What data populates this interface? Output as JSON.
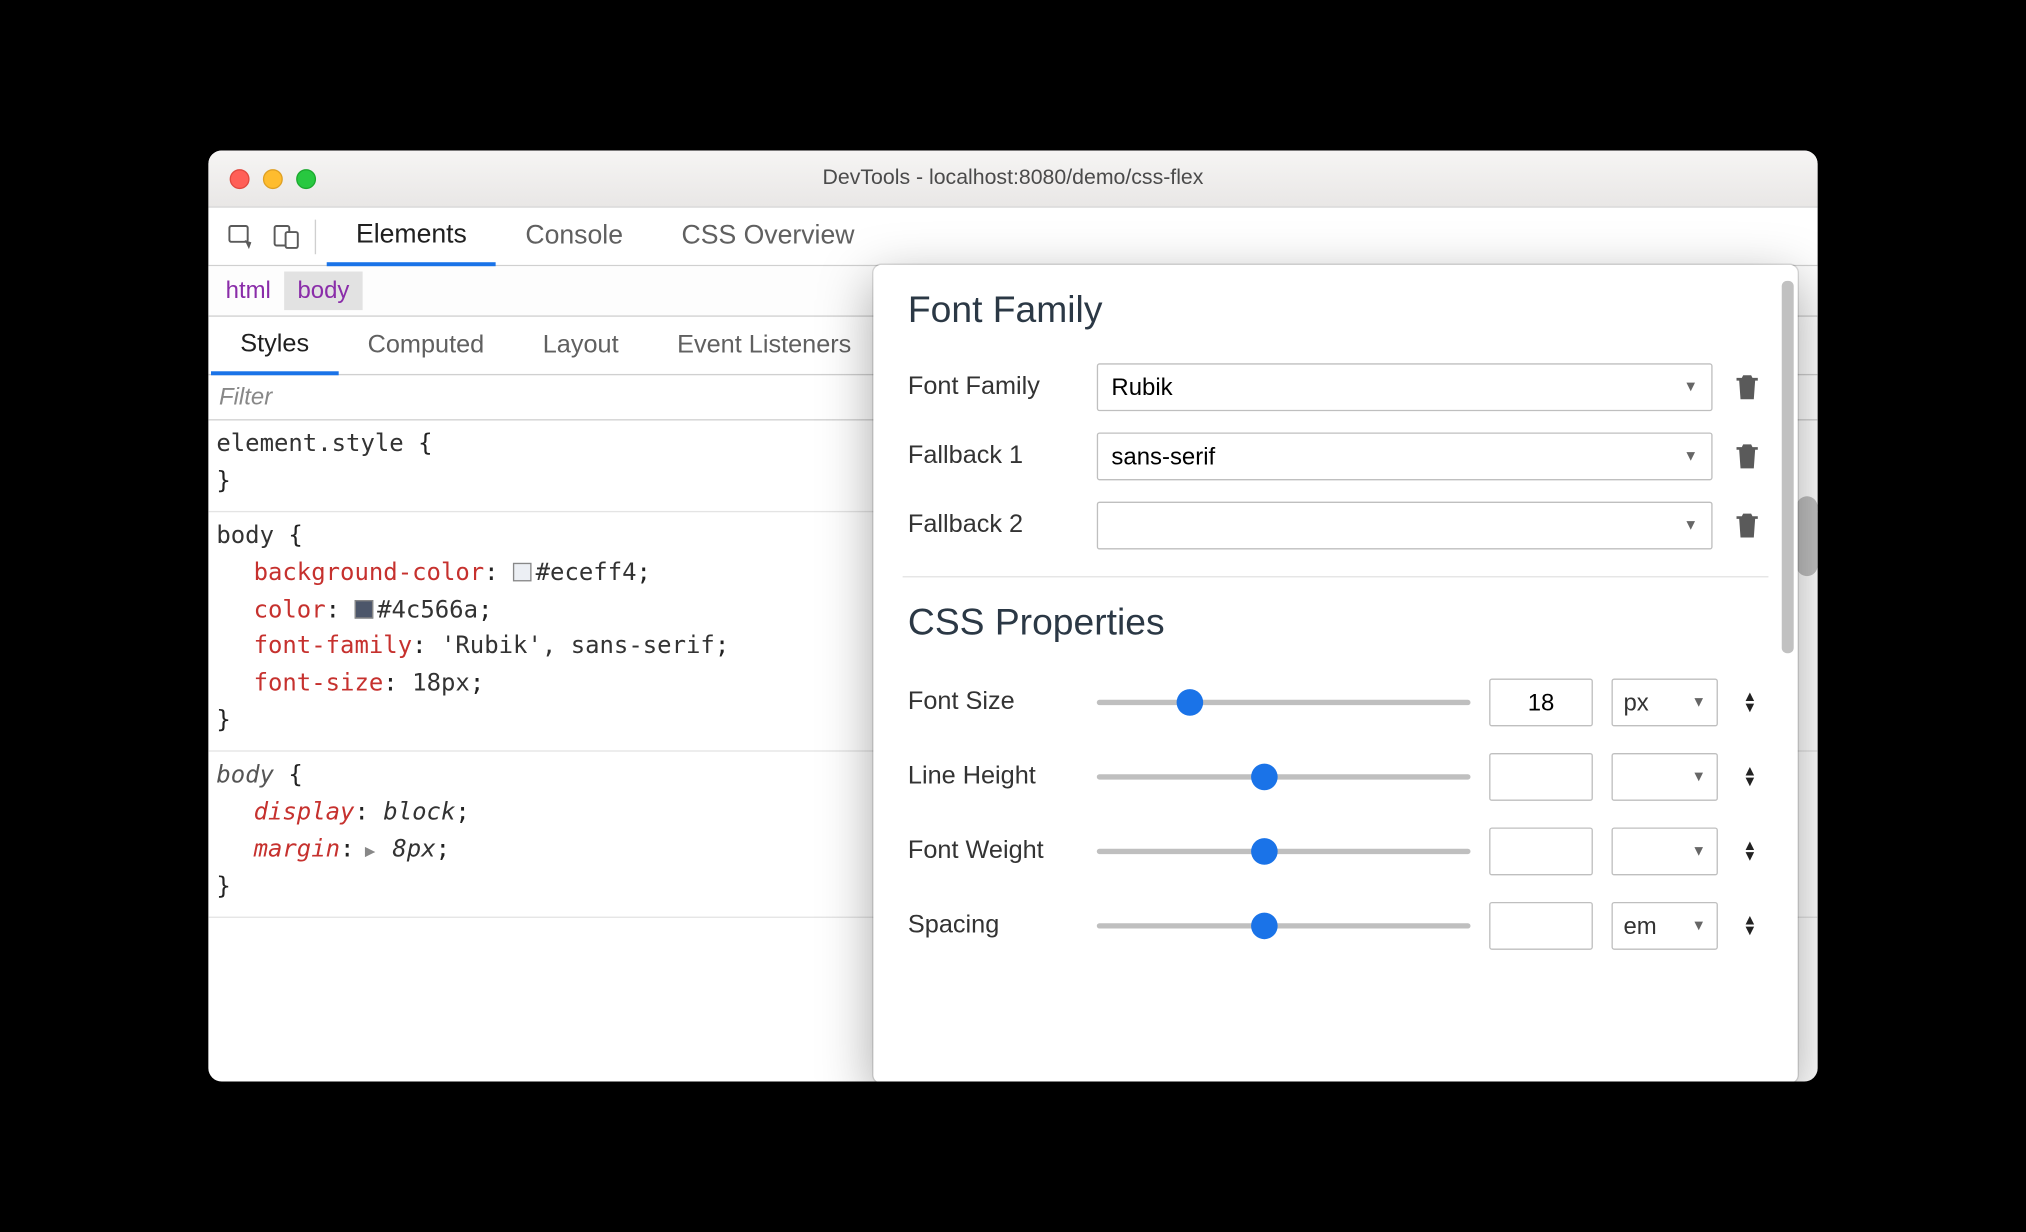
{
  "window": {
    "title": "DevTools - localhost:8080/demo/css-flex"
  },
  "main_tabs": [
    "Elements",
    "Console",
    "CSS Overview"
  ],
  "main_active": 0,
  "breadcrumb": [
    "html",
    "body"
  ],
  "breadcrumb_active": 1,
  "sub_tabs": [
    "Styles",
    "Computed",
    "Layout",
    "Event Listeners"
  ],
  "sub_active": 0,
  "filter_placeholder": "Filter",
  "styles": {
    "element_style": {
      "selector": "element.style",
      "open": "{",
      "close": "}"
    },
    "rule1": {
      "selector": "body",
      "open": "{",
      "close": "}",
      "decls": [
        {
          "prop": "background-color",
          "val": "#eceff4",
          "swatch": "#eceff4"
        },
        {
          "prop": "color",
          "val": "#4c566a",
          "swatch": "#4c566a"
        },
        {
          "prop": "font-family",
          "val": "'Rubik', sans-serif"
        },
        {
          "prop": "font-size",
          "val": "18px"
        }
      ]
    },
    "rule2": {
      "selector": "body",
      "open": "{",
      "close": "}",
      "italic": true,
      "decls": [
        {
          "prop": "display",
          "val": "block"
        },
        {
          "prop": "margin",
          "val": "8px",
          "expandable": true
        }
      ]
    }
  },
  "font_editor": {
    "section_family": "Font Family",
    "section_props": "CSS Properties",
    "family_row": {
      "label": "Font Family",
      "value": "Rubik"
    },
    "fallback1": {
      "label": "Fallback 1",
      "value": "sans-serif"
    },
    "fallback2": {
      "label": "Fallback 2",
      "value": ""
    },
    "props": [
      {
        "label": "Font Size",
        "slider": 25,
        "value": "18",
        "unit": "px"
      },
      {
        "label": "Line Height",
        "slider": 45,
        "value": "",
        "unit": ""
      },
      {
        "label": "Font Weight",
        "slider": 45,
        "value": "",
        "unit": "",
        "unit_disabled": true
      },
      {
        "label": "Spacing",
        "slider": 45,
        "value": "",
        "unit": "em"
      }
    ]
  }
}
